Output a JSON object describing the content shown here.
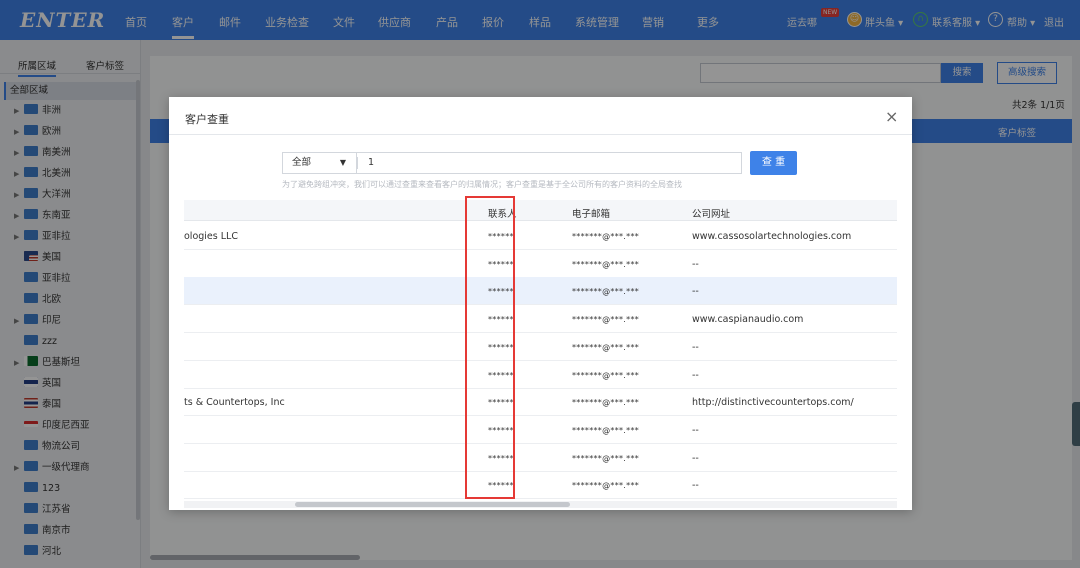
{
  "nav": {
    "logo": "ENTER",
    "items": [
      "首页",
      "客户",
      "邮件",
      "业务检查",
      "文件",
      "供应商",
      "产品",
      "报价",
      "样品",
      "系统管理",
      "营销",
      "更多"
    ],
    "active": "客户",
    "right": {
      "yunqu": "运去哪",
      "new_badge": "NEW",
      "user": "胖头鱼 ▾",
      "support": "联系客服 ▾",
      "help": "帮助 ▾",
      "logout": "退出"
    }
  },
  "sidebar": {
    "tabs": [
      "所属区域",
      "客户标签"
    ],
    "root": "全部区域",
    "items": [
      {
        "label": "非洲",
        "arrow": true,
        "flag": "region"
      },
      {
        "label": "欧洲",
        "arrow": true,
        "flag": "region"
      },
      {
        "label": "南美洲",
        "arrow": true,
        "flag": "region"
      },
      {
        "label": "北美洲",
        "arrow": true,
        "flag": "region"
      },
      {
        "label": "大洋洲",
        "arrow": true,
        "flag": "region"
      },
      {
        "label": "东南亚",
        "arrow": true,
        "flag": "region"
      },
      {
        "label": "亚非拉",
        "arrow": true,
        "flag": "region"
      },
      {
        "label": "美国",
        "arrow": false,
        "flag": "us"
      },
      {
        "label": "亚非拉",
        "arrow": false,
        "flag": "region"
      },
      {
        "label": "北欧",
        "arrow": false,
        "flag": "region"
      },
      {
        "label": "印尼",
        "arrow": true,
        "flag": "region"
      },
      {
        "label": "zzz",
        "arrow": false,
        "flag": "region"
      },
      {
        "label": "巴基斯坦",
        "arrow": true,
        "flag": "pk"
      },
      {
        "label": "英国",
        "arrow": false,
        "flag": "uk"
      },
      {
        "label": "泰国",
        "arrow": false,
        "flag": "th"
      },
      {
        "label": "印度尼西亚",
        "arrow": false,
        "flag": "id"
      },
      {
        "label": "物流公司",
        "arrow": false,
        "flag": "region"
      },
      {
        "label": "一级代理商",
        "arrow": true,
        "flag": "region"
      },
      {
        "label": "123",
        "arrow": false,
        "flag": "region"
      },
      {
        "label": "江苏省",
        "arrow": false,
        "flag": "region"
      },
      {
        "label": "南京市",
        "arrow": false,
        "flag": "region"
      },
      {
        "label": "河北",
        "arrow": false,
        "flag": "region"
      }
    ]
  },
  "background": {
    "search_btn": "搜索",
    "advanced_btn": "高级搜索",
    "pager": "共2条 1/1页",
    "column": "客户标签"
  },
  "modal": {
    "title": "客户查重",
    "close": "×",
    "select_value": "全部",
    "query_value": "1",
    "query_button": "查 重",
    "hint": "为了避免跨组冲突，我们可以通过查重来查看客户的归属情况；客户查重是基于全公司所有的客户资料的全局查找",
    "columns": [
      "联系人",
      "电子邮箱",
      "公司网址"
    ],
    "rows": [
      {
        "name": "ologies LLC",
        "contact": "******",
        "email": "*******@***.***",
        "website": "www.cassosolartechnologies.com",
        "highlight": false
      },
      {
        "name": "",
        "contact": "******",
        "email": "*******@***.***",
        "website": "--",
        "highlight": false
      },
      {
        "name": "",
        "contact": "******",
        "email": "*******@***.***",
        "website": "--",
        "highlight": true
      },
      {
        "name": "",
        "contact": "******",
        "email": "*******@***.***",
        "website": "www.caspianaudio.com",
        "highlight": false
      },
      {
        "name": "",
        "contact": "******",
        "email": "*******@***.***",
        "website": "--",
        "highlight": false
      },
      {
        "name": "",
        "contact": "******",
        "email": "*******@***.***",
        "website": "--",
        "highlight": false
      },
      {
        "name": "ts & Countertops, Inc",
        "contact": "******",
        "email": "*******@***.***",
        "website": "http://distinctivecountertops.com/",
        "highlight": false
      },
      {
        "name": "",
        "contact": "******",
        "email": "*******@***.***",
        "website": "--",
        "highlight": false
      },
      {
        "name": "",
        "contact": "******",
        "email": "*******@***.***",
        "website": "--",
        "highlight": false
      },
      {
        "name": "",
        "contact": "******",
        "email": "*******@***.***",
        "website": "--",
        "highlight": false
      }
    ]
  },
  "colors": {
    "primary": "#3e82e8",
    "highlight_box": "#e53935",
    "row_highlight": "#eaf1fc"
  }
}
